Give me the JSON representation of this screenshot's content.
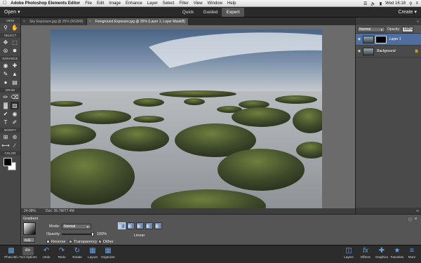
{
  "menubar": {
    "app": "Adobe Photoshop Elements Editor",
    "items": [
      "File",
      "Edit",
      "Image",
      "Enhance",
      "Layer",
      "Select",
      "Filter",
      "View",
      "Window",
      "Help"
    ],
    "clock": "Wed 16:18"
  },
  "modebar": {
    "open": "Open",
    "tabs": [
      "Quick",
      "Guided",
      "Expert"
    ],
    "create": "Create"
  },
  "toolbar": {
    "sections": [
      "VIEW",
      "SELECT",
      "ENHANCE",
      "DRAW",
      "MODIFY",
      "COLOR"
    ]
  },
  "documents": {
    "tabs": [
      {
        "label": "Sky Exposure.jpg @ 25% (RGB/8)"
      },
      {
        "label": "Foreground Exposure.jpg @ 25% (Layer 1, Layer Mask/8)"
      }
    ]
  },
  "status": {
    "zoom": "24.98%",
    "doc": "Doc: 35.7M/77.4M"
  },
  "options": {
    "section_label": "Gradient",
    "edit_label": "Edit...",
    "mode_label": "Mode:",
    "mode_value": "Normal",
    "opacity_label": "Opacity:",
    "opacity_value": "100%",
    "opacity_fraction": 1.0,
    "reverse_label": "Reverse",
    "transparency_label": "Transparency",
    "dither_label": "Dither",
    "type_label": "Linear",
    "reverse_checked": false,
    "transparency_checked": true,
    "dither_checked": true
  },
  "layers_panel": {
    "blend_mode": "Normal",
    "opacity_label": "Opacity:",
    "opacity_value": "100%",
    "layers": [
      {
        "name": "Layer 1",
        "selected": true
      },
      {
        "name": "Background",
        "selected": false
      }
    ]
  },
  "bottombar": {
    "left": [
      "Photo Bin",
      "Tool Options",
      "Undo",
      "Redo",
      "Rotate",
      "Layout",
      "Organizer"
    ],
    "right": [
      "Layers",
      "Effects",
      "Graphics",
      "Favorites",
      "More"
    ]
  }
}
